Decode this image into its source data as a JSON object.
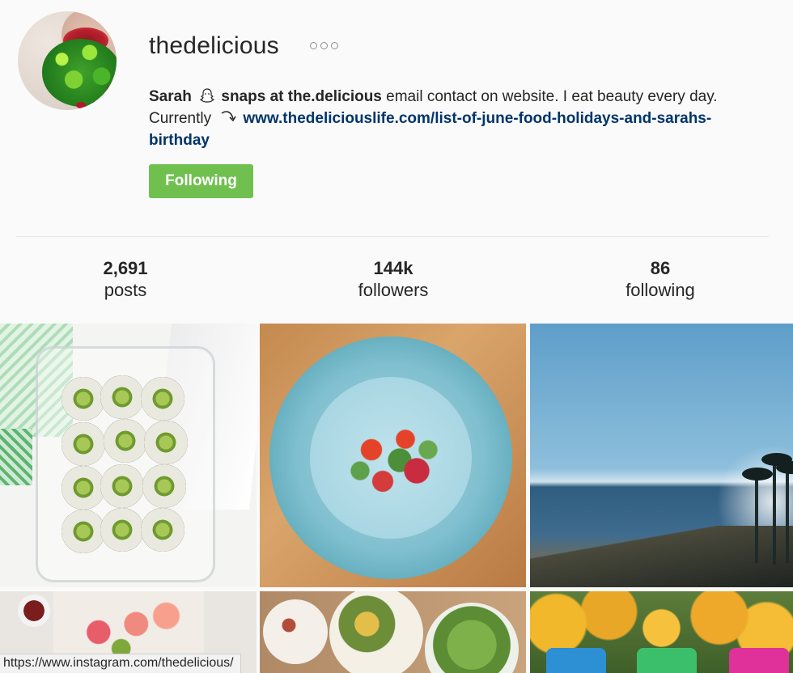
{
  "profile": {
    "username": "thedelicious",
    "bio": {
      "name": "Sarah",
      "snap_text": "snaps at the.delicious",
      "text_1": "email contact on website. I eat beauty every day. Currently",
      "link_text": "www.thedeliciouslife.com/list-of-june-food-holidays-and-sarahs-birthday"
    },
    "follow_button": "Following"
  },
  "stats": [
    {
      "value": "2,691",
      "label": "posts"
    },
    {
      "value": "144k",
      "label": "followers"
    },
    {
      "value": "86",
      "label": "following"
    }
  ],
  "status_bar": {
    "url": "https://www.instagram.com/thedelicious/"
  },
  "icons": [
    "more-options-icon",
    "snapchat-ghost-icon",
    "curved-arrow-icon"
  ],
  "colors": {
    "follow_button": "#70c050",
    "link": "#003569",
    "text": "#262626",
    "background": "#fafafa"
  }
}
